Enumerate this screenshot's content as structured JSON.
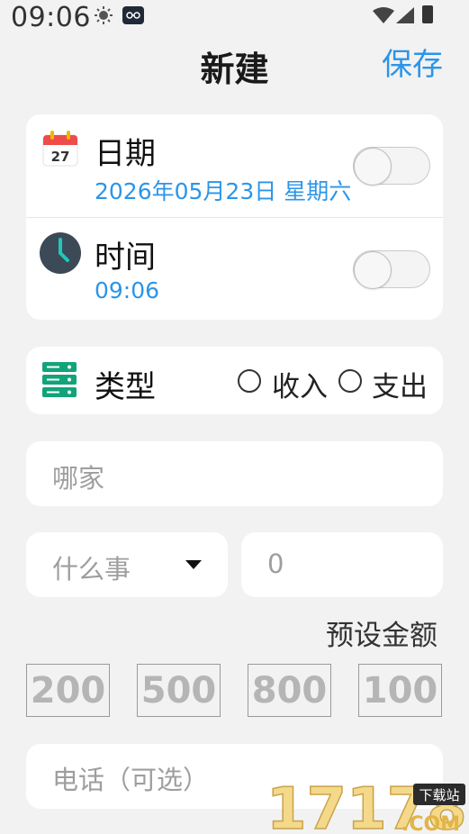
{
  "status_bar": {
    "time": "09:06",
    "icons": [
      "sun-icon",
      "app-notification-icon",
      "wifi-icon",
      "signal-icon",
      "battery-icon"
    ]
  },
  "header": {
    "title": "新建",
    "save_label": "保存"
  },
  "date_row": {
    "icon_day": "27",
    "label": "日期",
    "value": "2026年05月23日 星期六",
    "toggle_on": false
  },
  "time_row": {
    "label": "时间",
    "value": "09:06",
    "toggle_on": false
  },
  "type_row": {
    "label": "类型",
    "options": [
      {
        "label": "收入",
        "selected": false
      },
      {
        "label": "支出",
        "selected": false
      }
    ]
  },
  "where_input": {
    "placeholder": "哪家",
    "value": ""
  },
  "what_select": {
    "placeholder": "什么事",
    "value": ""
  },
  "amount_input": {
    "placeholder": "0",
    "value": ""
  },
  "presets": {
    "label": "预设金额",
    "values": [
      "200",
      "500",
      "800",
      "100"
    ]
  },
  "phone_input": {
    "placeholder": "电话（可选）",
    "value": ""
  },
  "watermark": {
    "text_big": "17178",
    "text_sub": ".COM",
    "badge": "下载站"
  },
  "colors": {
    "accent": "#2b95e9",
    "background": "#f2f2f2",
    "card": "#ffffff",
    "db_icon": "#12a37a"
  }
}
